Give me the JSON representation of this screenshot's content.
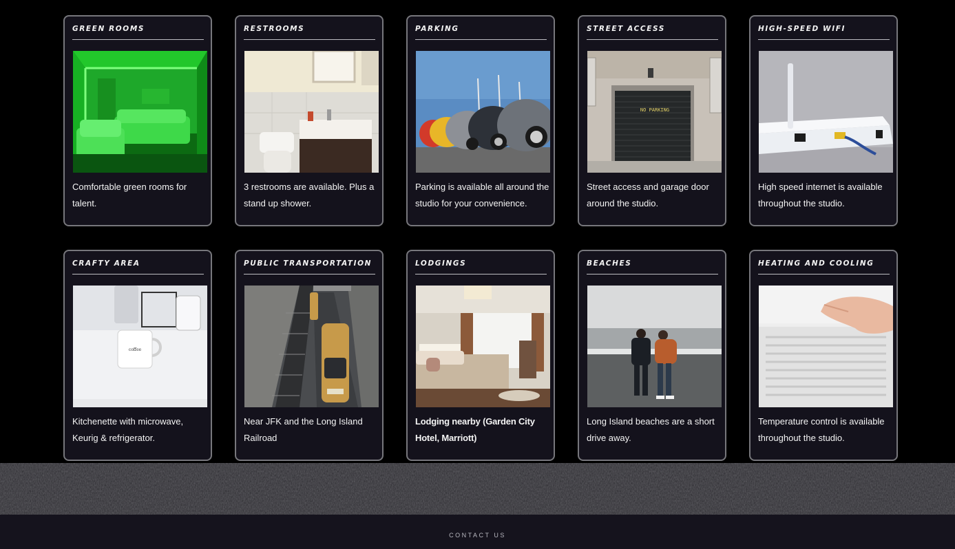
{
  "amenities": [
    {
      "title": "GREEN ROOMS",
      "description": "Comfortable green rooms for talent.",
      "photo": "green-room-photo"
    },
    {
      "title": "RESTROOMS",
      "description": "3 restrooms are available. Plus a stand up shower.",
      "photo": "restroom-photo"
    },
    {
      "title": " PARKING",
      "description": "Parking is available all around the studio for your convenience.",
      "photo": "parking-photo"
    },
    {
      "title": "STREET ACCESS",
      "description": "Street access and garage door around the studio.",
      "photo": "garage-door-photo",
      "sign_text": "NO PARKING"
    },
    {
      "title": "HIGH-SPEED WIFI",
      "description": "High speed internet is available throughout the studio.",
      "photo": "router-photo"
    },
    {
      "title": "CRAFTY AREA",
      "description": "Kitchenette with microwave, Keurig & refrigerator.",
      "photo": "coffee-mug-photo",
      "mug_text": "coffee"
    },
    {
      "title": "PUBLIC TRANSPORTATION",
      "description": "Near JFK and the Long Island Railroad",
      "photo": "train-station-photo"
    },
    {
      "title": "LODGINGS",
      "description": "Lodging nearby (Garden City Hotel, Marriott)",
      "photo": "hotel-room-photo"
    },
    {
      "title": "BEACHES",
      "description": "Long Island beaches are a short drive away.",
      "photo": "beach-photo"
    },
    {
      "title": "HEATING AND COOLING",
      "description": "Temperature control is available throughout the studio.",
      "photo": "air-vent-photo"
    }
  ],
  "footer": {
    "contact_label": "CONTACT US"
  },
  "colors": {
    "page_background": "#000000",
    "card_background": "#14121c",
    "card_border": "#77777c",
    "footer_background": "#15131d",
    "texture_band": "#2a292e"
  }
}
